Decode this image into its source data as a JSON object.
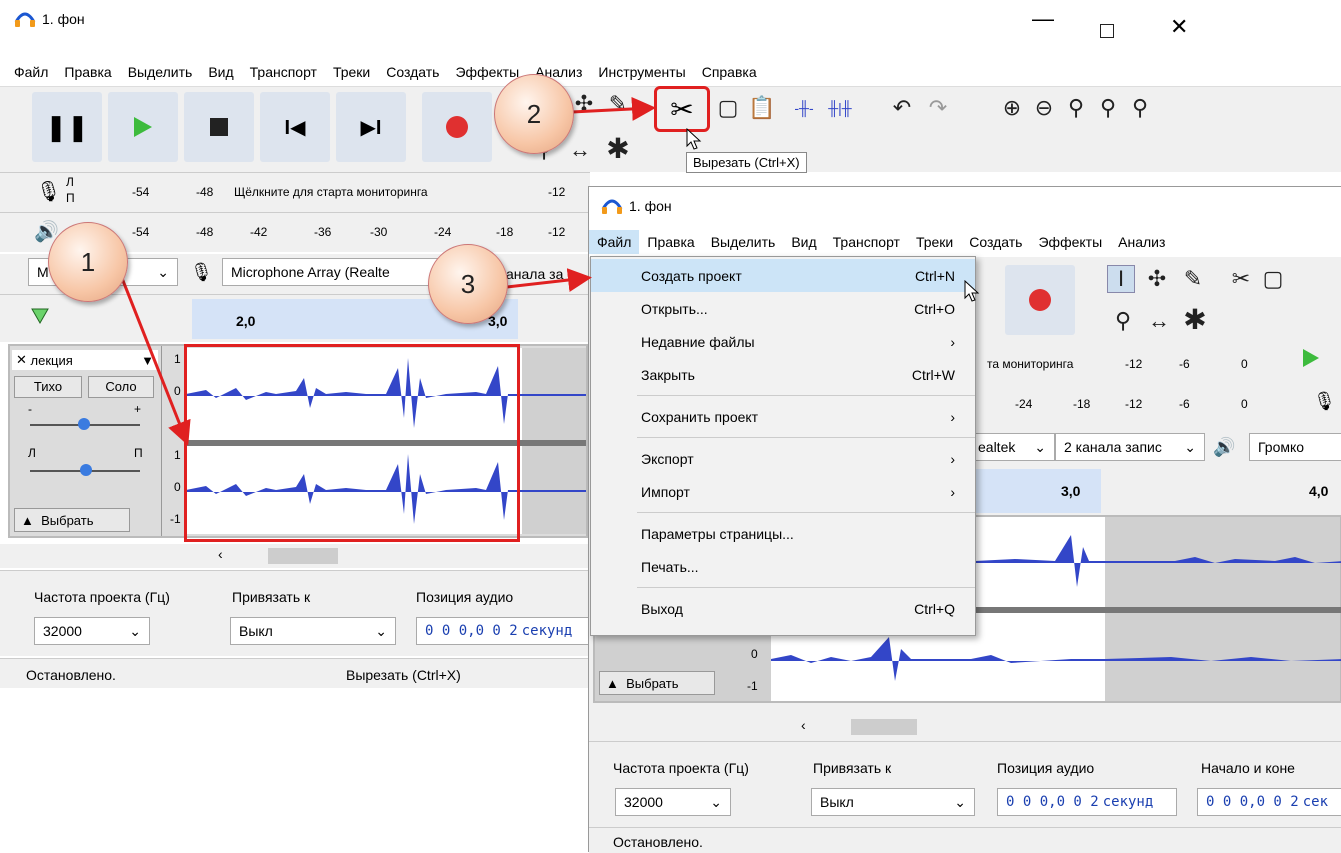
{
  "back_window": {
    "title": "1. фон",
    "menu": [
      "Файл",
      "Правка",
      "Выделить",
      "Вид",
      "Транспорт",
      "Треки",
      "Создать",
      "Эффекты",
      "Анализ",
      "Инструменты",
      "Справка"
    ],
    "rec_meter_text": "Щёлкните для старта мониторинга",
    "rec_ticks": [
      "-54",
      "-48",
      "-12"
    ],
    "play_ticks": [
      "-54",
      "-48",
      "-42",
      "-36",
      "-30",
      "-24",
      "-18",
      "-12"
    ],
    "lr": [
      "Л",
      "П"
    ],
    "host_short": "M",
    "mic_device": "Microphone Array (Realte",
    "channels_short": "анала за",
    "timeline_labels": [
      "2,0",
      "3,0"
    ],
    "track": {
      "name": "лекция",
      "mute": "Тихо",
      "solo": "Соло",
      "minus": "-",
      "plus": "+",
      "pan_l": "Л",
      "pan_r": "П",
      "select": "Выбрать"
    },
    "scale": [
      "1",
      "0",
      "-",
      "1",
      "0",
      "-1"
    ],
    "tooltip": "Вырезать (Ctrl+X)",
    "bottom": {
      "rate_label": "Частота проекта (Гц)",
      "snap_label": "Привязать к",
      "pos_label": "Позиция аудио",
      "rate_value": "32000",
      "snap_value": "Выкл",
      "pos_value": "0 0 0,0 0 2",
      "pos_unit": "секунд"
    },
    "status_left": "Остановлено.",
    "status_right": "Вырезать (Ctrl+X)"
  },
  "front_window": {
    "title": "1. фон",
    "menu": [
      "Файл",
      "Правка",
      "Выделить",
      "Вид",
      "Транспорт",
      "Треки",
      "Создать",
      "Эффекты",
      "Анализ"
    ],
    "meter_text": "та мониторинга",
    "meter_ticks": [
      "-12",
      "-6",
      "0"
    ],
    "play_ticks": [
      "-24",
      "-18",
      "-12",
      "-6",
      "0"
    ],
    "device_tail": "ealtek",
    "channels": "2 канала запис",
    "volume_label": "Громко",
    "timeline_labels": [
      "3,0",
      "4,0"
    ],
    "track_select": "Выбрать",
    "scale": [
      "0",
      "-1"
    ],
    "bottom": {
      "rate_label": "Частота проекта (Гц)",
      "snap_label": "Привязать к",
      "pos_label": "Позиция аудио",
      "range_label": "Начало и коне",
      "rate_value": "32000",
      "snap_value": "Выкл",
      "pos_value": "0 0 0,0 0 2",
      "pos_unit": "секунд",
      "range_value": "0 0 0,0 0 2",
      "range_unit": "сек"
    },
    "status": "Остановлено."
  },
  "file_menu": {
    "items": [
      {
        "label": "Создать проект",
        "shortcut": "Ctrl+N",
        "arrow": ""
      },
      {
        "label": "Открыть...",
        "shortcut": "Ctrl+O",
        "arrow": ""
      },
      {
        "label": "Недавние файлы",
        "shortcut": "",
        "arrow": "›"
      },
      {
        "label": "Закрыть",
        "shortcut": "Ctrl+W",
        "arrow": ""
      },
      {
        "label": "Сохранить проект",
        "shortcut": "",
        "arrow": "›"
      },
      {
        "label": "Экспорт",
        "shortcut": "",
        "arrow": "›"
      },
      {
        "label": "Импорт",
        "shortcut": "",
        "arrow": "›"
      },
      {
        "label": "Параметры страницы...",
        "shortcut": "",
        "arrow": ""
      },
      {
        "label": "Печать...",
        "shortcut": "",
        "arrow": ""
      },
      {
        "label": "Выход",
        "shortcut": "Ctrl+Q",
        "arrow": ""
      }
    ]
  },
  "callouts": [
    "1",
    "2",
    "3"
  ],
  "colors": {
    "wave": "#3346c8",
    "highlight": "#e02020",
    "record": "#e03030",
    "play": "#3dbb3d",
    "menu_sel": "#cce4f7"
  }
}
